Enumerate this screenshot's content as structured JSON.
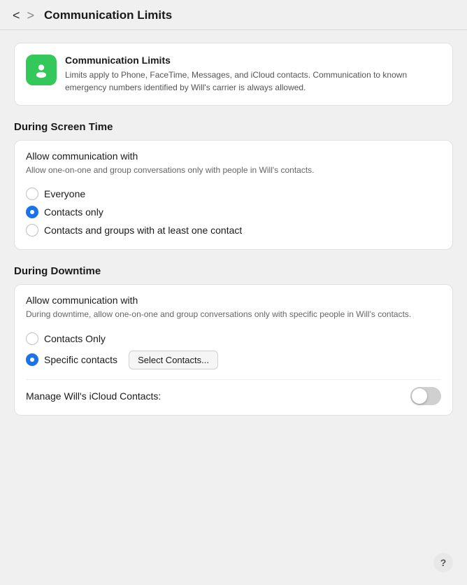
{
  "titleBar": {
    "title": "Communication Limits",
    "backLabel": "<",
    "forwardLabel": ">"
  },
  "infoCard": {
    "title": "Communication Limits",
    "description": "Limits apply to Phone, FaceTime, Messages, and iCloud contacts. Communication to known emergency numbers identified by Will's carrier is always allowed.",
    "iconAlt": "communication-limits-icon"
  },
  "screenTimeSection": {
    "header": "During Screen Time",
    "cardTitle": "Allow communication with",
    "cardDesc": "Allow one-on-one and group conversations only with people in Will's contacts.",
    "options": [
      {
        "id": "everyone",
        "label": "Everyone",
        "selected": false
      },
      {
        "id": "contacts-only",
        "label": "Contacts only",
        "selected": true
      },
      {
        "id": "contacts-groups",
        "label": "Contacts and groups with at least one contact",
        "selected": false
      }
    ]
  },
  "downtimeSection": {
    "header": "During Downtime",
    "cardTitle": "Allow communication with",
    "cardDesc": "During downtime, allow one-on-one and group conversations only with specific people in Will's contacts.",
    "options": [
      {
        "id": "contacts-only-dt",
        "label": "Contacts Only",
        "selected": false
      },
      {
        "id": "specific-contacts",
        "label": "Specific contacts",
        "selected": true
      }
    ],
    "selectButtonLabel": "Select Contacts...",
    "manageLabel": "Manage Will's iCloud Contacts:",
    "toggleOn": false
  },
  "helpButton": "?"
}
